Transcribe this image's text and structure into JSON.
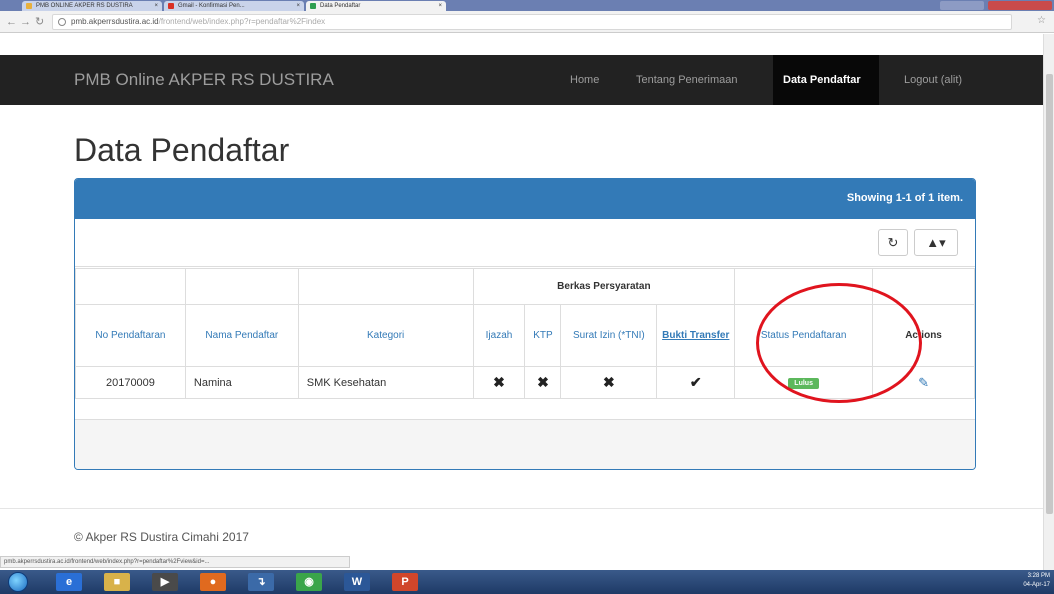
{
  "browser": {
    "tabs": [
      {
        "label": "PMB ONLINE AKPER RS DUSTIRA",
        "color": "#e8b03c"
      },
      {
        "label": "Gmail - Konfirmasi Pen...",
        "color": "#d93025"
      },
      {
        "label": "Data Pendaftar",
        "color": "#2e9e4f"
      }
    ],
    "url_host": "pmb.akperrsdustira.ac.id",
    "url_path": "/frontend/web/index.php?r=pendaftar%2Findex",
    "status_url": "pmb.akperrsdustira.ac.id/frontend/web/index.php?r=pendaftar%2Fview&id=..."
  },
  "navbar": {
    "brand": "PMB Online AKPER RS DUSTIRA",
    "links": [
      "Home",
      "Tentang Penerimaan",
      "Data Pendaftar",
      "Logout (alit)"
    ],
    "active": "Data Pendaftar"
  },
  "page": {
    "title": "Data Pendaftar",
    "summary": "Showing 1-1 of 1 item.",
    "refresh_icon": "refresh-icon",
    "export_icon": "export-icon"
  },
  "table": {
    "group_header": "Berkas Persyaratan",
    "columns": {
      "no": "No Pendaftaran",
      "nama": "Nama Pendaftar",
      "kategori": "Kategori",
      "ijazah": "Ijazah",
      "ktp": "KTP",
      "surat": "Surat Izin (*TNI)",
      "bukti": "Bukti Transfer",
      "status": "Status Pendaftaran",
      "actions": "Actions"
    },
    "rows": [
      {
        "no": "20170009",
        "nama": "Namina",
        "kategori": "SMK Kesehatan",
        "ijazah": "✖",
        "ktp": "✖",
        "surat": "✖",
        "bukti": "✔",
        "status": "Lulus",
        "action_icon": "pencil-icon"
      }
    ]
  },
  "footer": {
    "text": "© Akper RS Dustira Cimahi 2017"
  },
  "taskbar": {
    "time": "3:28 PM",
    "date": "04-Apr-17"
  },
  "colors": {
    "primary": "#337ab7",
    "navbar": "#222222",
    "badge": "#5cb85c",
    "annotation": "#e0141e"
  }
}
